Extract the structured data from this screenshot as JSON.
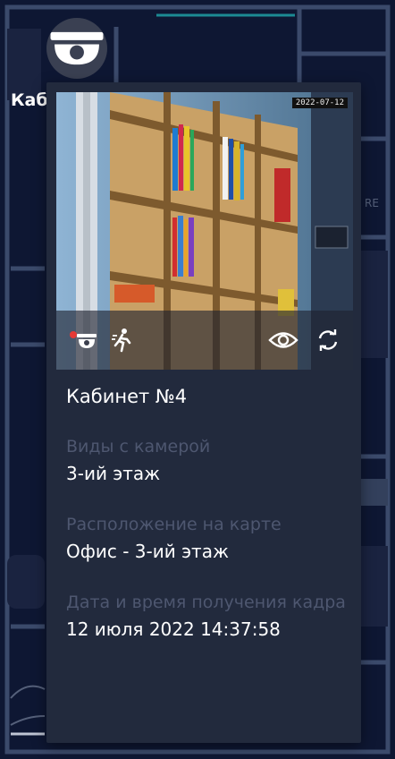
{
  "map": {
    "room_label": "Каб",
    "partial_text": "RE"
  },
  "camera_popup": {
    "timestamp": "2022-07-12",
    "room_name": "Кабинет №4",
    "views_label": "Виды с камерой",
    "views_value": "3-ий этаж",
    "location_label": "Расположение на карте",
    "location_value": "Офис - 3-ий этаж",
    "frame_time_label": "Дата и время получения кадра",
    "frame_time_value": "12 июля 2022 14:37:58",
    "controls": [
      "camera-record-icon",
      "motion-icon",
      "eye-icon",
      "refresh-icon"
    ]
  },
  "colors": {
    "map_background": "#0e1733",
    "popup_background": "#222a3d",
    "label_muted": "#4e5770",
    "text_primary": "#ffffff",
    "record_dot": "#e53935",
    "map_accent": "#1c8a93"
  }
}
